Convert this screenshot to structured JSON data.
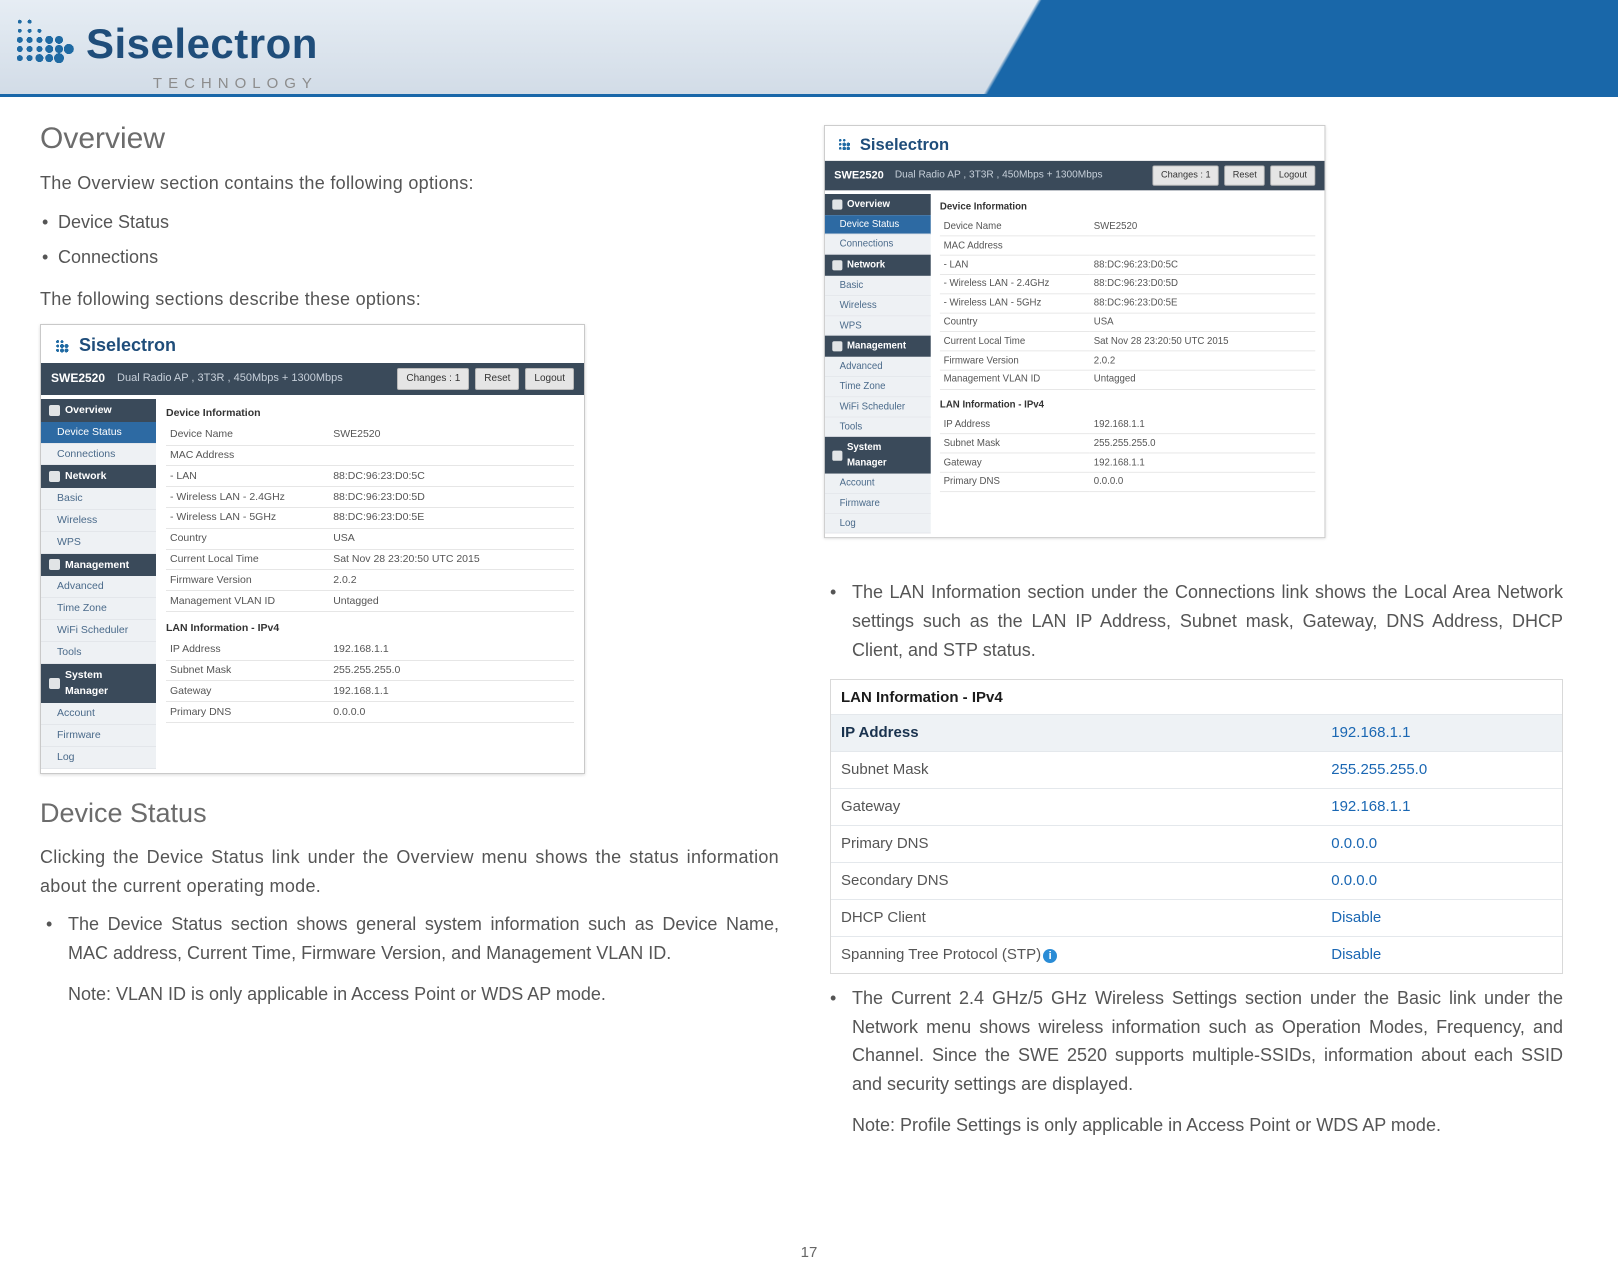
{
  "page_number": "17",
  "brand": {
    "name": "Siselectron",
    "sub": "TECHNOLOGY",
    "dots": "• • • • •"
  },
  "left": {
    "h_overview": "Overview",
    "intro": "The Overview section  contains the  following  options:",
    "opts": [
      "Device Status",
      "Connections"
    ],
    "intro2": "The following  sections describe these  options:",
    "h_device_status": "Device  Status",
    "ds_p1": "Clicking the  Device  Status link under  the  Overview menu shows  the status  information about  the  current  operating mode.",
    "bullet1": "The Device Status section shows general system information such as Device Name, MAC  address,  Current  Time, Firmware  Version,  and Management VLAN ID.",
    "note1": "Note:   VLAN ID is only applicable  in Access  Point  or WDS AP mode."
  },
  "right": {
    "bullet_lan": "The  LAN Information  section under  the  Connections link shows the  Local Area Network  settings such  as  the LAN  IP  Address, Subnet  mask,  Gateway,  DNS Address, DHCP Client, and  STP status.",
    "bullet_wifi": "The   Current   2.4   GHz/5   GHz  Wireless   Settings section under  the  Basic  link under  the  Network menu shows  wireless information such  as  Operation  Modes, Frequency,  and Channel. Since  the  SWE 2520  supports multiple-SSIDs, information  about each  SSID and  security settings are  displayed.",
    "note_wifi": "Note:  Profile Settings is only applicable  in Access  Point or  WDS AP mode."
  },
  "router": {
    "brand": "Siselectron",
    "model": "SWE2520",
    "desc": "Dual Radio AP , 3T3R , 450Mbps + 1300Mbps",
    "changes_label": "Changes : 1",
    "reset_label": "Reset",
    "logout_label": "Logout",
    "nav": {
      "overview": "Overview",
      "device_status": "Device Status",
      "connections": "Connections",
      "network": "Network",
      "basic": "Basic",
      "wireless": "Wireless",
      "wps": "WPS",
      "management": "Management",
      "advanced": "Advanced",
      "time_zone": "Time Zone",
      "wifi_sched": "WiFi Scheduler",
      "tools": "Tools",
      "system_manager": "System Manager",
      "account": "Account",
      "firmware": "Firmware",
      "log": "Log"
    },
    "sec_devinfo": "Device Information",
    "dev_rows": [
      [
        "Device Name",
        "SWE2520"
      ],
      [
        "MAC Address",
        ""
      ],
      [
        "  - LAN",
        "88:DC:96:23:D0:5C"
      ],
      [
        "  - Wireless LAN - 2.4GHz",
        "88:DC:96:23:D0:5D"
      ],
      [
        "  - Wireless LAN - 5GHz",
        "88:DC:96:23:D0:5E"
      ],
      [
        "Country",
        "USA"
      ],
      [
        "Current Local Time",
        "Sat Nov 28 23:20:50 UTC 2015"
      ],
      [
        "Firmware Version",
        "2.0.2"
      ],
      [
        "Management VLAN ID",
        "Untagged"
      ]
    ],
    "sec_laninfo": "LAN Information - IPv4",
    "lan_rows": [
      [
        "IP Address",
        "192.168.1.1"
      ],
      [
        "Subnet Mask",
        "255.255.255.0"
      ],
      [
        "Gateway",
        "192.168.1.1"
      ],
      [
        "Primary DNS",
        "0.0.0.0"
      ]
    ]
  },
  "lan_table": {
    "title": "LAN Information - IPv4",
    "header": [
      "IP Address",
      "192.168.1.1"
    ],
    "rows": [
      [
        "Subnet Mask",
        "255.255.255.0"
      ],
      [
        "Gateway",
        "192.168.1.1"
      ],
      [
        "Primary DNS",
        "0.0.0.0"
      ],
      [
        "Secondary DNS",
        "0.0.0.0"
      ],
      [
        "DHCP Client",
        "Disable"
      ],
      [
        "Spanning Tree Protocol (STP)",
        "Disable"
      ]
    ]
  }
}
